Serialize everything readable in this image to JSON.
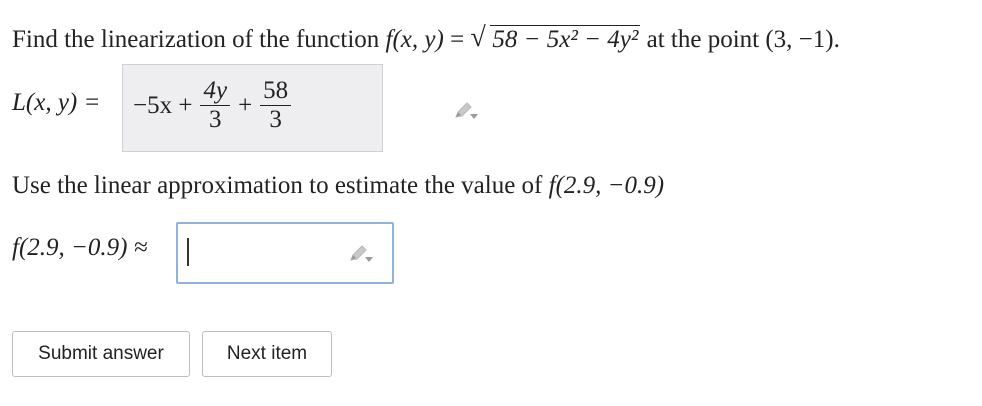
{
  "question": {
    "prefix": "Find the linearization of the function ",
    "func_name": "f",
    "func_args": "(x, y)",
    "equals": " = ",
    "radicand": "58 − 5x² − 4y²",
    "at_text": " at the point ",
    "point": "(3, −1)."
  },
  "part1": {
    "lhs": "L(x, y) =",
    "term1": "−5x +",
    "frac1_num": "4y",
    "frac1_den": "3",
    "plus": "+",
    "frac2_num": "58",
    "frac2_den": "3"
  },
  "instruction": {
    "text": "Use the linear approximation to estimate the value of ",
    "func_call": "f(2.9, −0.9)"
  },
  "part2": {
    "lhs": "f(2.9, −0.9) ≈",
    "value": ""
  },
  "buttons": {
    "submit_label": "Submit answer",
    "next_label": "Next item"
  },
  "icons": {
    "pencil": "pencil-edit-icon"
  }
}
